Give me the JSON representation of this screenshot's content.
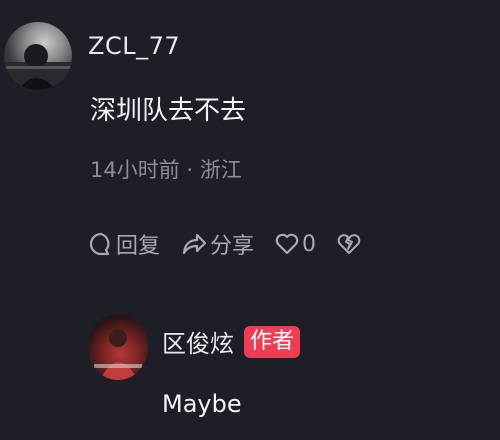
{
  "comment": {
    "username": "ZCL_77",
    "text": "深圳队去不去",
    "meta": "14小时前 · 浙江",
    "actions": {
      "reply_label": "回复",
      "share_label": "分享",
      "like_count": "0"
    }
  },
  "reply": {
    "username": "区俊炫",
    "badge": "作者",
    "text": "Maybe"
  },
  "colors": {
    "background": "#1e1e26",
    "badge": "#f03d56",
    "secondary_text": "#8e8e99"
  }
}
